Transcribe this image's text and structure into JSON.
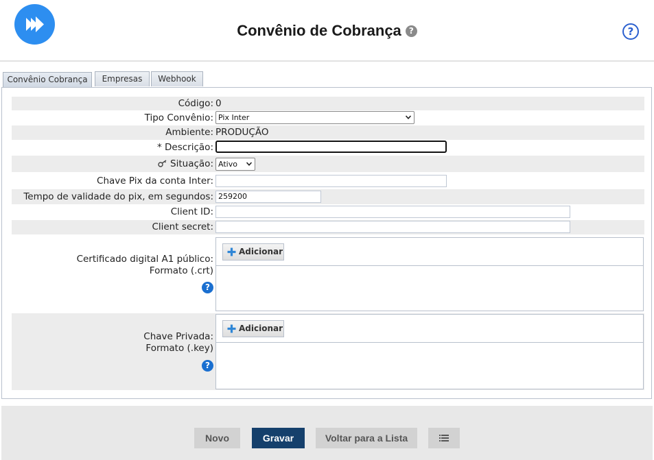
{
  "header": {
    "title": "Convênio de Cobrança",
    "title_help_icon": "question-circle-icon",
    "help_icon": "question-circle-outline-icon",
    "logo_icon": "fast-forward-logo-icon"
  },
  "tabs": [
    {
      "label": "Convênio Cobrança",
      "active": true
    },
    {
      "label": "Empresas",
      "active": false
    },
    {
      "label": "Webhook",
      "active": false
    }
  ],
  "form": {
    "codigo": {
      "label": "Código:",
      "value": "0"
    },
    "tipo_convenio": {
      "label": "Tipo Convênio:",
      "value": "Pix Inter"
    },
    "ambiente": {
      "label": "Ambiente:",
      "value": "PRODUÇÃO"
    },
    "descricao": {
      "label": "* Descrição:",
      "value": ""
    },
    "situacao": {
      "label": "Situação:",
      "value": "Ativo",
      "icon": "key-icon"
    },
    "chave_pix": {
      "label": "Chave Pix da conta Inter:",
      "value": ""
    },
    "tempo_validade": {
      "label": "Tempo de validade do pix, em segundos:",
      "value": "259200"
    },
    "client_id": {
      "label": "Client ID:",
      "value": ""
    },
    "client_secret": {
      "label": "Client secret:",
      "value": ""
    },
    "certificado": {
      "label_line1": "Certificado digital A1 público:",
      "label_line2": "Formato (.crt)",
      "button": "Adicionar"
    },
    "chave_privada": {
      "label_line1": "Chave Privada:",
      "label_line2": "Formato (.key)",
      "button": "Adicionar"
    }
  },
  "footer": {
    "novo": "Novo",
    "gravar": "Gravar",
    "voltar": "Voltar para a Lista",
    "list_icon": "list-icon"
  },
  "colors": {
    "brand_blue": "#2d8ef0",
    "primary_button": "#15406c",
    "help_blue": "#1a6fd0"
  }
}
